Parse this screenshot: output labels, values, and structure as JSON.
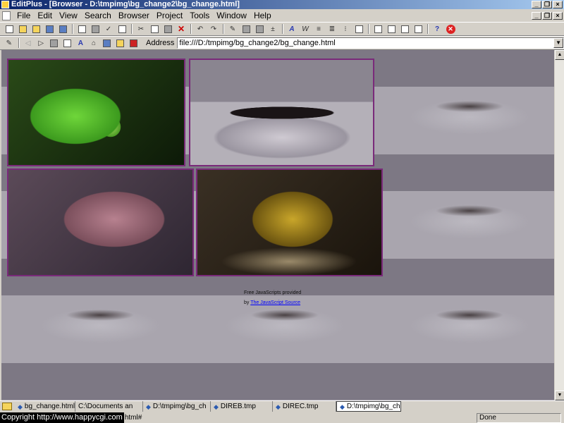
{
  "window": {
    "title": "EditPlus - [Browser - D:\\tmpimg\\bg_change2\\bg_change.html]"
  },
  "menu": [
    "File",
    "Edit",
    "View",
    "Search",
    "Browser",
    "Project",
    "Tools",
    "Window",
    "Help"
  ],
  "address": {
    "label": "Address",
    "value": "file:///D:/tmpimg/bg_change2/bg_change.html"
  },
  "page": {
    "credit_line1": "Free JavaScripts provided",
    "credit_by": "by",
    "credit_link": "The JavaScript Source"
  },
  "tabs": [
    "bg_change.html",
    "C:\\Documents an",
    "D:\\tmpimg\\bg_ch",
    "DIREB.tmp",
    "DIREC.tmp",
    "D:\\tmpimg\\bg_ch"
  ],
  "status": {
    "copyright": "Copyright   http://www.happycgi.com",
    "suffix": "html#",
    "state": "Done"
  }
}
